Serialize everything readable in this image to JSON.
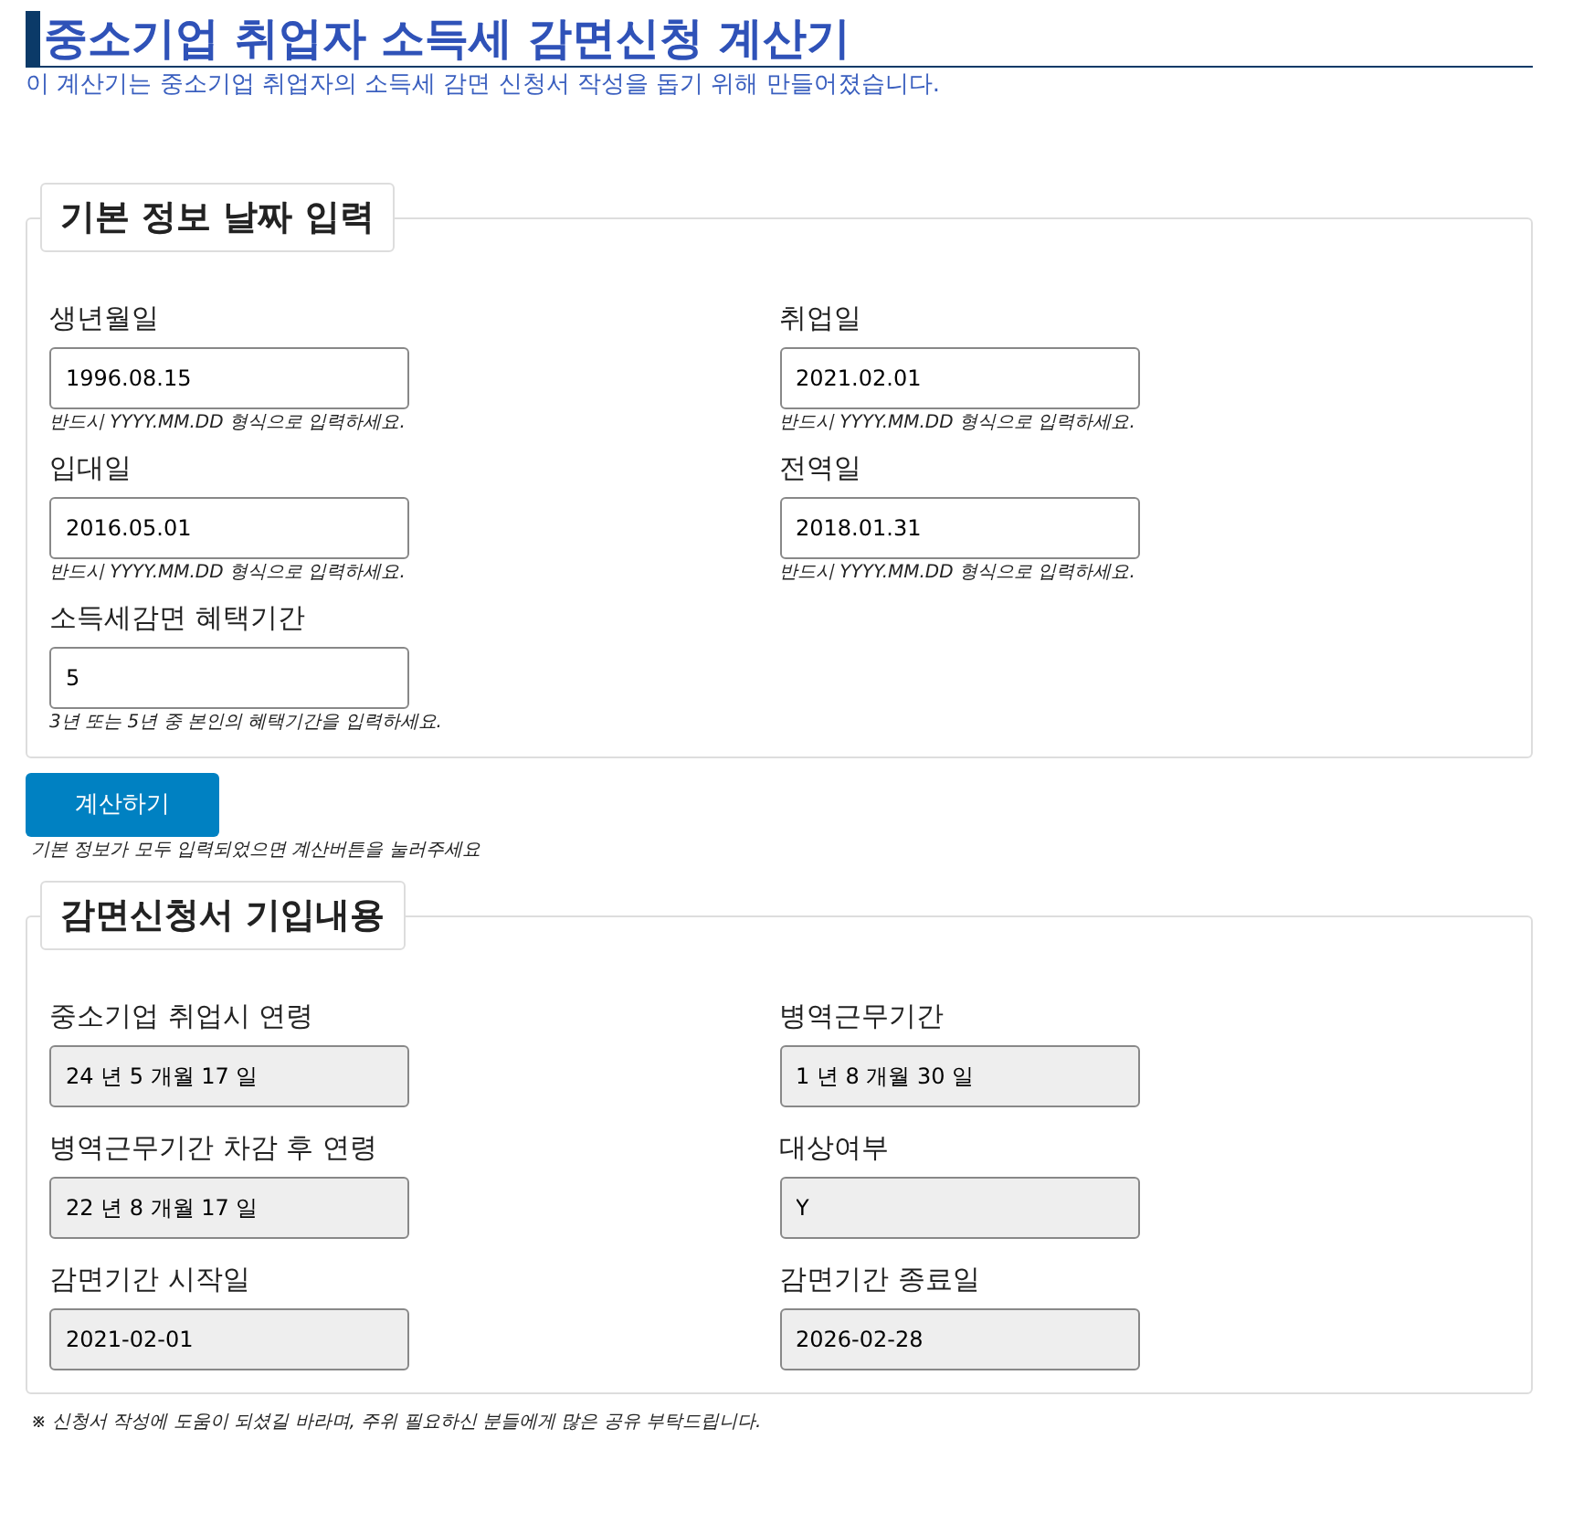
{
  "title": "중소기업 취업자 소득세 감면신청 계산기",
  "subtitle": "이 계산기는 중소기업 취업자의 소득세 감면 신청서 작성을 돕기 위해 만들어졌습니다.",
  "input_section": {
    "legend": "기본 정보 날짜 입력",
    "fields": [
      {
        "label": "생년월일",
        "value": "1996.08.15",
        "help": "반드시 YYYY.MM.DD 형식으로 입력하세요.",
        "readonly": false
      },
      {
        "label": "취업일",
        "value": "2021.02.01",
        "help": "반드시 YYYY.MM.DD 형식으로 입력하세요.",
        "readonly": false
      },
      {
        "label": "입대일",
        "value": "2016.05.01",
        "help": "반드시 YYYY.MM.DD 형식으로 입력하세요.",
        "readonly": false
      },
      {
        "label": "전역일",
        "value": "2018.01.31",
        "help": "반드시 YYYY.MM.DD 형식으로 입력하세요.",
        "readonly": false
      },
      {
        "label": "소득세감면 혜택기간",
        "value": "5",
        "help": "3년 또는 5년 중 본인의 혜택기간을 입력하세요.",
        "readonly": false
      }
    ]
  },
  "calculate_button": {
    "label": "계산하기",
    "help": "기본 정보가 모두 입력되었으면 계산버튼을 눌러주세요"
  },
  "result_section": {
    "legend": "감면신청서 기입내용",
    "fields": [
      {
        "label": "중소기업 취업시 연령",
        "value": "24 년 5 개월 17 일",
        "readonly": true
      },
      {
        "label": "병역근무기간",
        "value": "1 년 8 개월 30 일",
        "readonly": true
      },
      {
        "label": "병역근무기간 차감 후 연령",
        "value": "22 년 8 개월 17 일",
        "readonly": true
      },
      {
        "label": "대상여부",
        "value": "Y",
        "readonly": true
      },
      {
        "label": "감면기간 시작일",
        "value": "2021-02-01",
        "readonly": true
      },
      {
        "label": "감면기간 종료일",
        "value": "2026-02-28",
        "readonly": true
      }
    ]
  },
  "footnote": "※ 신청서 작성에 도움이 되셨길 바라며, 주위 필요하신 분들에게 많은 공유 부탁드립니다."
}
